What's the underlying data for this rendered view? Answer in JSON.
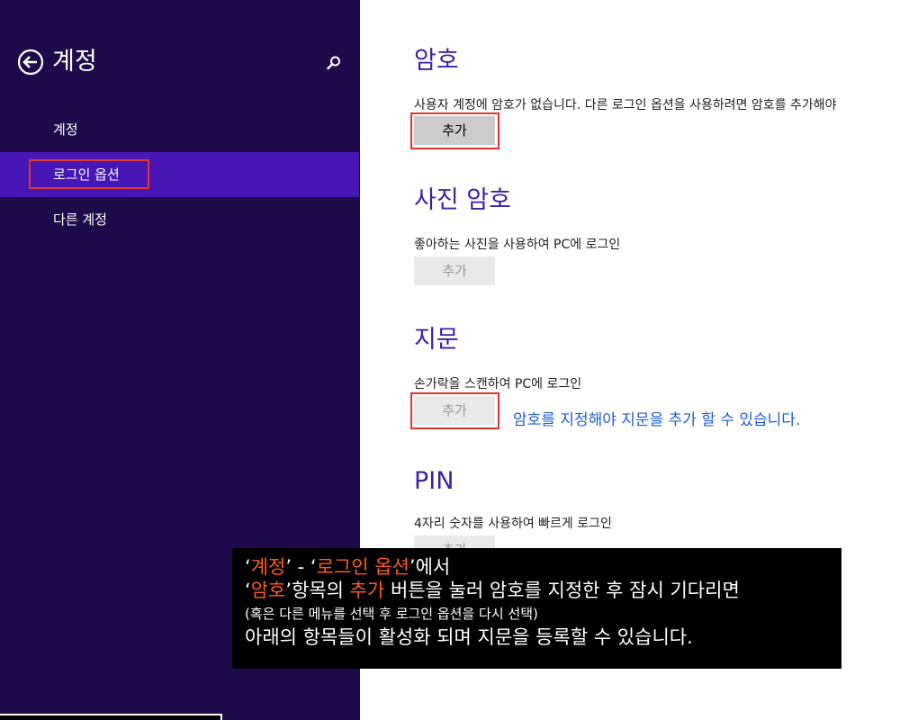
{
  "sidebar": {
    "title": "계정",
    "back_icon": "back-arrow-icon",
    "search_icon": "search-icon",
    "items": [
      {
        "label": "계정",
        "active": false
      },
      {
        "label": "로그인 옵션",
        "active": true
      },
      {
        "label": "다른 계정",
        "active": false
      }
    ]
  },
  "sections": [
    {
      "title": "암호",
      "desc": "사용자 계정에 암호가 없습니다. 다른 로그인 옵션을 사용하려면 암호를 추가해야",
      "button": "추가",
      "enabled": true
    },
    {
      "title": "사진 암호",
      "desc": "좋아하는 사진을 사용하여 PC에 로그인",
      "button": "추가",
      "enabled": false
    },
    {
      "title": "지문",
      "desc": "손가락을 스캔하여 PC에 로그인",
      "button": "추가",
      "enabled": false
    },
    {
      "title": "PIN",
      "desc": "4자리 숫자를 사용하여 빠르게 로그인",
      "button": "추가",
      "enabled": false
    }
  ],
  "annotation": "암호를 지정해야 지문을 추가 할 수 있습니다.",
  "overlay": {
    "l1": [
      "‘",
      "계정",
      "’ - ‘",
      "로그인 옵션",
      "’에서"
    ],
    "l2": [
      "‘",
      "암호",
      "’항목의 ",
      "추가",
      " 버튼을 눌러 암호를 지정한 후 잠시 기다리면"
    ],
    "l3": "(혹은 다른 메뉴를 선택 후 로그인 옵션을 다시 선택)",
    "l4": "아래의 항목들이 활성화 되며 지문을 등록할 수 있습니다."
  },
  "colors": {
    "sidebar_bg": "#1e0a4b",
    "sidebar_active": "#4617b4",
    "title_purple": "#3e1fa5",
    "highlight_red": "#e2342b",
    "annotation_blue": "#1f5bd9",
    "overlay_highlight": "#ff5a1f"
  }
}
